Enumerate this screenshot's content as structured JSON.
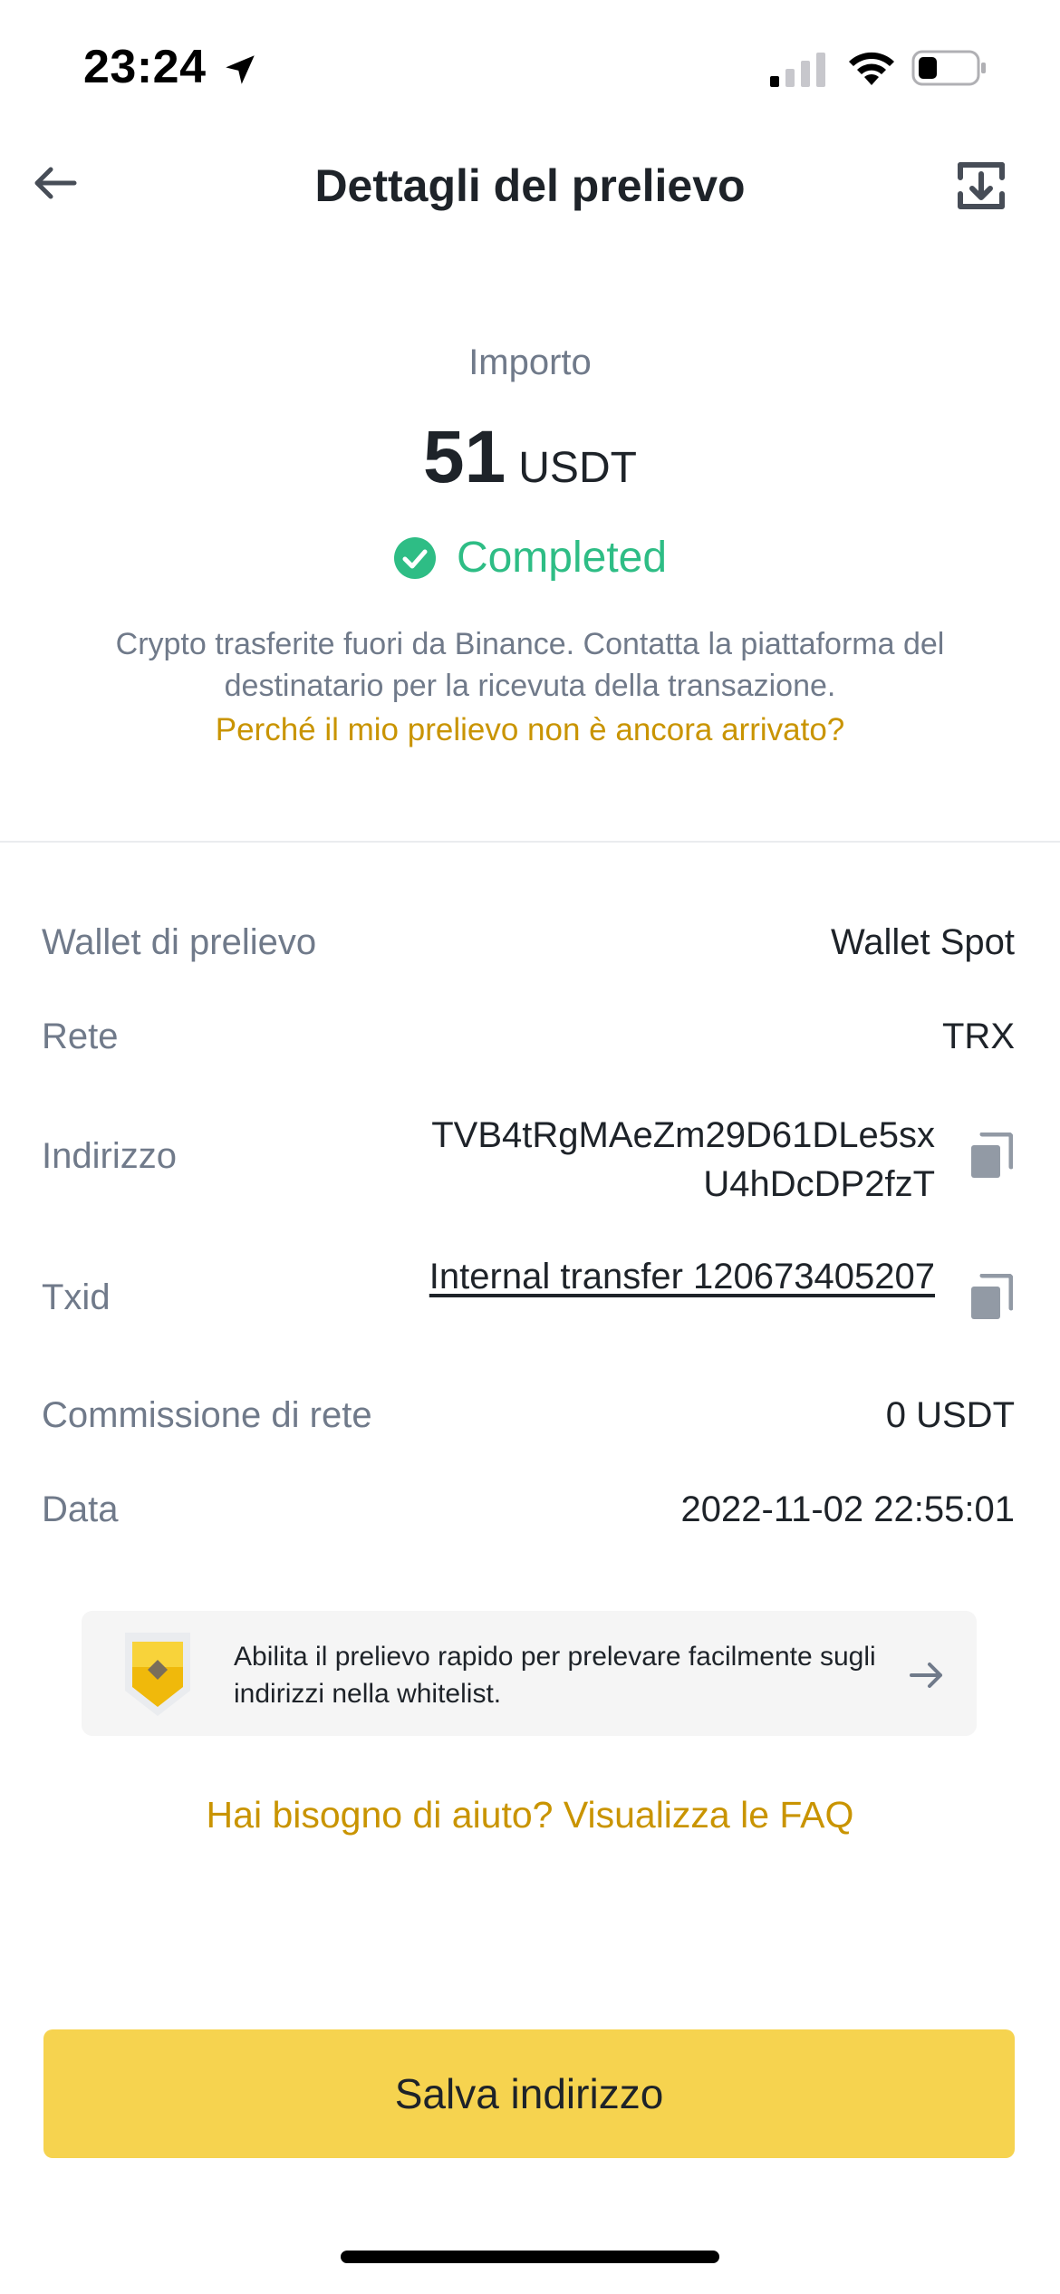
{
  "status_bar": {
    "time": "23:24"
  },
  "header": {
    "title": "Dettagli del prelievo",
    "back_icon": "arrow-left-icon",
    "action_icon": "export-icon"
  },
  "amount": {
    "label": "Importo",
    "value": "51",
    "unit": "USDT"
  },
  "status": {
    "text": "Completed",
    "color": "#2ebd85"
  },
  "info": {
    "text": "Crypto trasferite fuori da Binance. Contatta la piattaforma del destinatario per la ricevuta della transazione.",
    "link": "Perché il mio prelievo non è ancora arrivato?"
  },
  "details": {
    "wallet": {
      "label": "Wallet di prelievo",
      "value": "Wallet Spot"
    },
    "network": {
      "label": "Rete",
      "value": "TRX"
    },
    "address": {
      "label": "Indirizzo",
      "value": "TVB4tRgMAeZm29D61DLe5sxU4hDcDP2fzT"
    },
    "txid": {
      "label": "Txid",
      "value": "Internal transfer 120673405207"
    },
    "fee": {
      "label": "Commissione di rete",
      "value": "0 USDT"
    },
    "date": {
      "label": "Data",
      "value": "2022-11-02 22:55:01"
    }
  },
  "banner": {
    "text": "Abilita il prelievo rapido per prelevare facilmente sugli indirizzi nella whitelist."
  },
  "faq_link": "Hai bisogno di aiuto? Visualizza le FAQ",
  "save_button": "Salva indirizzo",
  "colors": {
    "accent": "#c99400",
    "button": "#f6d34f",
    "success": "#2ebd85"
  }
}
